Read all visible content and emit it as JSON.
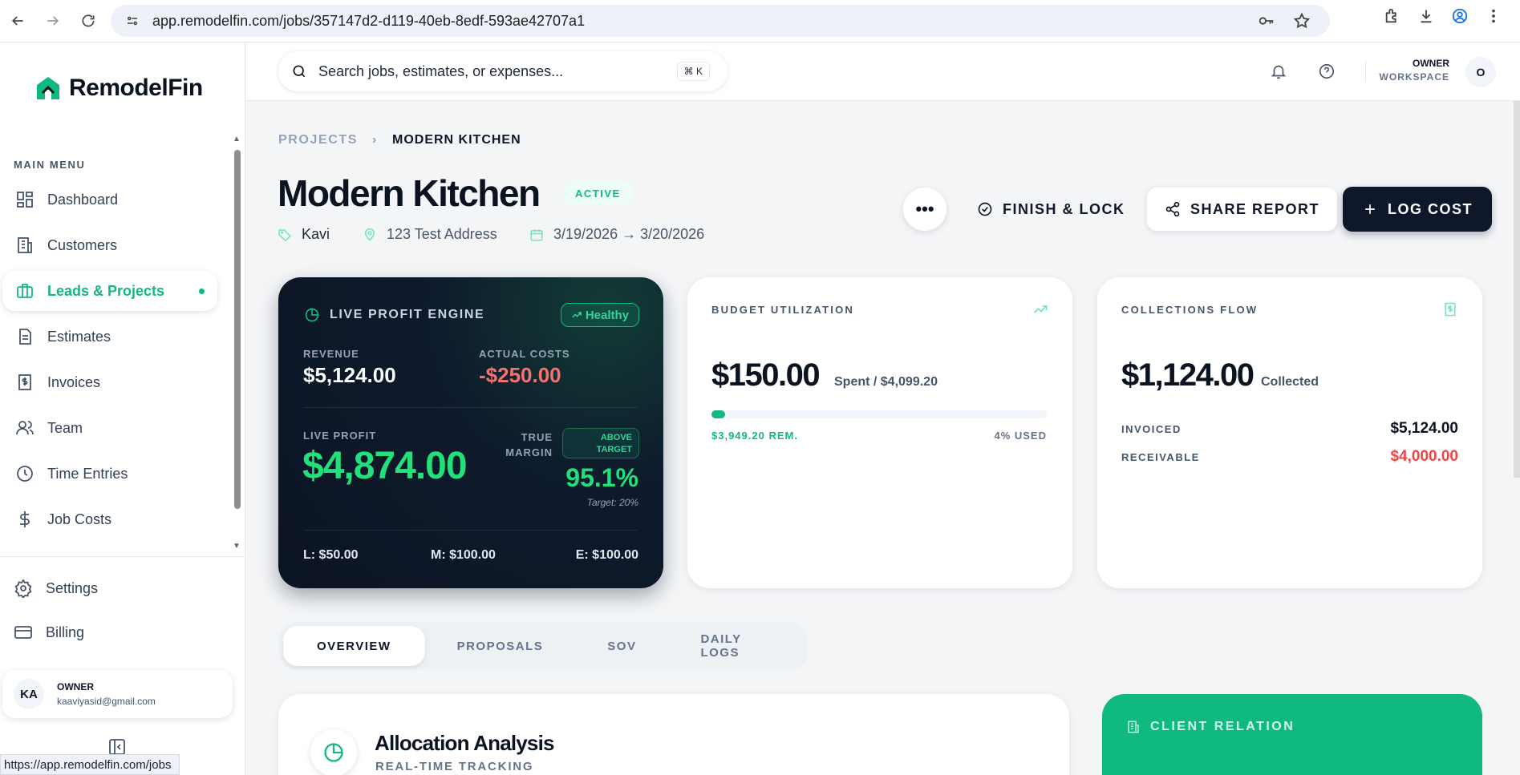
{
  "browser": {
    "url": "app.remodelfin.com/jobs/357147d2-d119-40eb-8edf-593ae42707a1",
    "status_url": "https://app.remodelfin.com/jobs"
  },
  "sidebar": {
    "brand": "RemodelFin",
    "menu_label": "MAIN MENU",
    "items": [
      {
        "label": "Dashboard",
        "icon": "dashboard-icon"
      },
      {
        "label": "Customers",
        "icon": "building-icon"
      },
      {
        "label": "Leads & Projects",
        "icon": "briefcase-icon",
        "active": true
      },
      {
        "label": "Estimates",
        "icon": "document-icon"
      },
      {
        "label": "Invoices",
        "icon": "invoice-icon"
      },
      {
        "label": "Team",
        "icon": "team-icon"
      },
      {
        "label": "Time Entries",
        "icon": "clock-icon"
      },
      {
        "label": "Job Costs",
        "icon": "dollar-icon"
      }
    ],
    "settings_label": "Settings",
    "billing_label": "Billing",
    "user": {
      "initials": "KA",
      "role": "OWNER",
      "email": "kaaviyasid@gmail.com"
    }
  },
  "topbar": {
    "search_placeholder": "Search jobs, estimates, or expenses...",
    "shortcut": "⌘ K",
    "workspace_role": "OWNER",
    "workspace_name": "WORKSPACE",
    "avatar": "O"
  },
  "project": {
    "breadcrumb_root": "PROJECTS",
    "breadcrumb_current": "MODERN KITCHEN",
    "title": "Modern Kitchen",
    "status": "ACTIVE",
    "client": "Kavi",
    "address": "123 Test Address",
    "dates": "3/19/2026 → 3/20/2026"
  },
  "actions": {
    "more": "•••",
    "finish": "FINISH & LOCK",
    "share": "SHARE REPORT",
    "log_cost": "LOG COST"
  },
  "profit_engine": {
    "title": "LIVE PROFIT ENGINE",
    "health": "Healthy",
    "revenue_label": "REVENUE",
    "revenue": "$5,124.00",
    "costs_label": "ACTUAL COSTS",
    "costs": "-$250.00",
    "profit_label": "LIVE PROFIT",
    "profit": "$4,874.00",
    "margin_label_1": "TRUE",
    "margin_label_2": "MARGIN",
    "target_badge_1": "ABOVE",
    "target_badge_2": "TARGET",
    "margin": "95.1%",
    "target_note": "Target: 20%",
    "labor": "L: $50.00",
    "materials": "M: $100.00",
    "equipment": "E: $100.00"
  },
  "budget": {
    "title": "BUDGET UTILIZATION",
    "spent": "$150.00",
    "suffix": "Spent / $4,099.20",
    "used_fraction": 0.04,
    "remaining": "$3,949.20 REM.",
    "used": "4% USED"
  },
  "collections": {
    "title": "COLLECTIONS FLOW",
    "collected": "$1,124.00",
    "suffix": "Collected",
    "invoiced_label": "INVOICED",
    "invoiced": "$5,124.00",
    "receivable_label": "RECEIVABLE",
    "receivable": "$4,000.00"
  },
  "tabs": [
    {
      "label": "OVERVIEW",
      "active": true
    },
    {
      "label": "PROPOSALS"
    },
    {
      "label": "SOV"
    },
    {
      "label": "DAILY LOGS"
    }
  ],
  "allocation": {
    "title": "Allocation Analysis",
    "subtitle": "REAL-TIME TRACKING"
  },
  "client_relation": {
    "title": "CLIENT RELATION"
  },
  "colors": {
    "accent": "#10b981",
    "dark": "#0f172a",
    "negative": "#ef4444"
  }
}
